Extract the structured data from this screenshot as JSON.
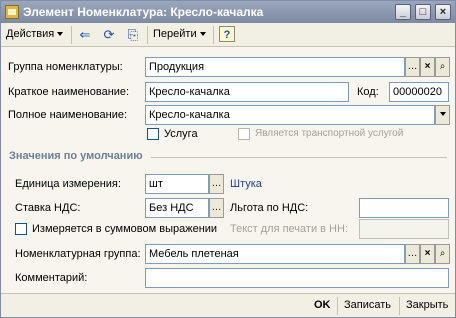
{
  "window": {
    "title": "Элемент Номенклатура: Кресло-качалка"
  },
  "toolbar": {
    "actions_label": "Действия",
    "goto_label": "Перейти",
    "help_label": "?"
  },
  "form": {
    "group_label": "Группа номенклатуры:",
    "group_value": "Продукция",
    "short_name_label": "Краткое наименование:",
    "short_name_value": "Кресло-качалка",
    "code_label": "Код:",
    "code_value": "00000020",
    "full_name_label": "Полное наименование:",
    "full_name_value": "Кресло-качалка",
    "service_label": "Услуга",
    "transport_label": "Является транспортной услугой",
    "section_label": "Значения по умолчанию",
    "unit_label": "Единица измерения:",
    "unit_value": "шт",
    "unit_link": "Штука",
    "vat_label": "Ставка НДС:",
    "vat_value": "Без НДС",
    "vat_benefit_label": "Льгота по НДС:",
    "vat_benefit_value": "",
    "sum_measure_label": "Измеряется в суммовом выражении",
    "print_text_label": "Текст для печати в НН:",
    "print_text_value": "",
    "item_group_label": "Номенклатурная группа:",
    "item_group_value": "Мебель плетеная",
    "comment_label": "Комментарий:",
    "comment_value": ""
  },
  "bottom": {
    "ok_label": "OK",
    "save_label": "Записать",
    "close_label": "Закрыть"
  }
}
